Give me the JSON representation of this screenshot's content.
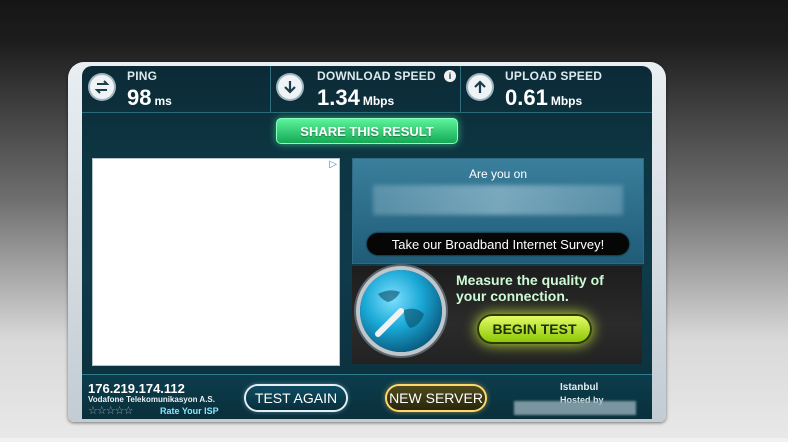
{
  "stats": {
    "ping": {
      "label": "PING",
      "value": "98",
      "unit": "ms"
    },
    "download": {
      "label": "DOWNLOAD SPEED",
      "value": "1.34",
      "unit": "Mbps"
    },
    "upload": {
      "label": "UPLOAD SPEED",
      "value": "0.61",
      "unit": "Mbps"
    }
  },
  "share_button": "SHARE THIS RESULT",
  "ad": {
    "mark": "▷"
  },
  "survey": {
    "title": "Are you on",
    "button": "Take our Broadband Internet Survey!"
  },
  "measure": {
    "text": "Measure the quality of your connection.",
    "button": "BEGIN TEST"
  },
  "footer": {
    "ip": "176.219.174.112",
    "isp": "Vodafone Telekomunikasyon A.S.",
    "rate": "Rate Your ISP",
    "stars": "☆☆☆☆☆",
    "test_again": "TEST AGAIN",
    "new_server": "NEW SERVER",
    "city": "Istanbul",
    "hosted": "Hosted by"
  },
  "icons": {
    "ping": "ping-exchange-icon",
    "download": "download-arrow-icon",
    "upload": "upload-arrow-icon",
    "info": "info-icon",
    "globe": "globe-icon"
  },
  "colors": {
    "accent_green": "#2ddb79",
    "begin_yellow": "#c8ef2a",
    "server_gold": "#ffd86a"
  }
}
